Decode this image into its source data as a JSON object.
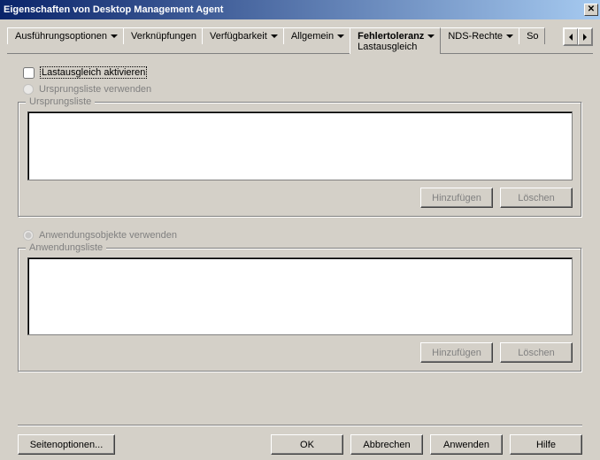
{
  "title": "Eigenschaften von Desktop Management Agent",
  "tabs": {
    "items": [
      "Ausführungsoptionen",
      "Verknüpfungen",
      "Verfügbarkeit",
      "Allgemein",
      "Fehlertoleranz",
      "NDS-Rechte",
      "So"
    ],
    "active_index": 4,
    "active_subtitle": "Lastausgleich"
  },
  "controls": {
    "activate_checkbox_label": "Lastausgleich aktivieren",
    "activate_checked": false,
    "use_sourcelist_radio_label": "Ursprungsliste verwenden",
    "use_applist_radio_label": "Anwendungsobjekte verwenden"
  },
  "groups": {
    "sourcelist_legend": "Ursprungsliste",
    "applist_legend": "Anwendungsliste",
    "add_label": "Hinzufügen",
    "delete_label": "Löschen"
  },
  "bottom": {
    "page_options": "Seitenoptionen...",
    "ok": "OK",
    "cancel": "Abbrechen",
    "apply": "Anwenden",
    "help": "Hilfe"
  }
}
